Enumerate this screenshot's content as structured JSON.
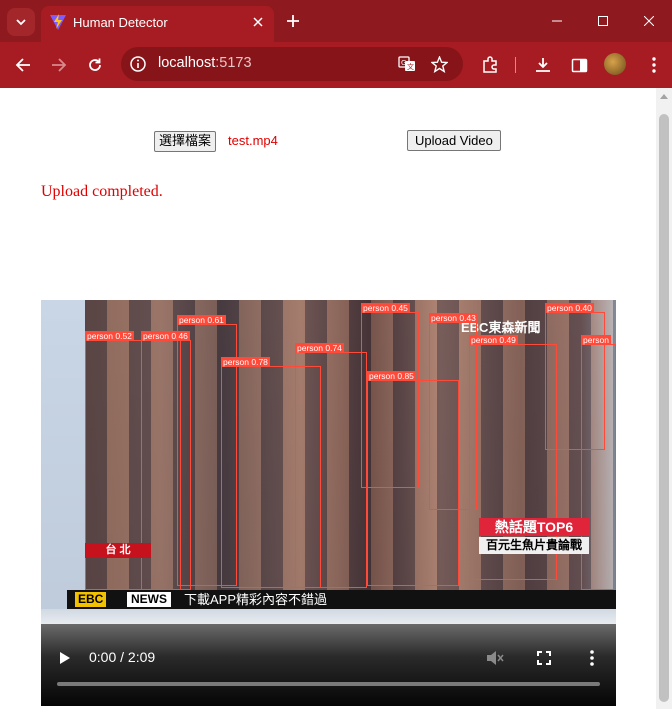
{
  "browser": {
    "tab_title": "Human Detector",
    "url_host": "localhost",
    "url_port": ":5173"
  },
  "page": {
    "file_button_label": "選擇檔案",
    "file_name": "test.mp4",
    "upload_button_label": "Upload Video",
    "status_text": "Upload completed."
  },
  "video": {
    "time_display": "0:00 / 2:09",
    "progress": 0,
    "overlay": {
      "channel_logo": "EBC東森新聞",
      "hot_topic": "熱話題TOP6",
      "hot_topic_sub": "百元生魚片貴論戰",
      "city": "台 北",
      "ticker_logo": "EBC",
      "ticker_news": "NEWS",
      "ticker_text": "下載APP精彩內容不錯過"
    },
    "detections": [
      {
        "label": "person 0.52"
      },
      {
        "label": "person 0.46"
      },
      {
        "label": "person 0.61"
      },
      {
        "label": "person 0.78"
      },
      {
        "label": "person 0.74"
      },
      {
        "label": "person 0.45"
      },
      {
        "label": "person 0.43"
      },
      {
        "label": "person 0.85"
      },
      {
        "label": "person 0.49"
      },
      {
        "label": "person 0.40"
      },
      {
        "label": "person"
      }
    ]
  },
  "colors": {
    "chrome_frame": "#8e1a1f",
    "chrome_toolbar": "#a61c22",
    "status_red": "#e00000",
    "bbox": "#ff4a3a"
  }
}
